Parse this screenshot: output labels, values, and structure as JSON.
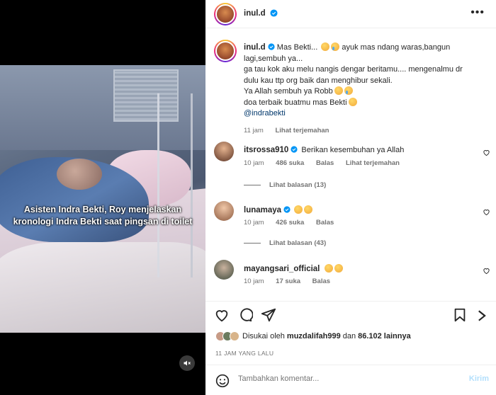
{
  "video": {
    "caption": "Asisten Indra Bekti, Roy menjelaskan kronologi Indra Bekti saat pingsan di toilet"
  },
  "post": {
    "author": "inul.d"
  },
  "caption": {
    "author": "inul.d",
    "line1": "Mas Bekti...",
    "line1b": "ayuk mas ndang waras,bangun",
    "line2": "lagi,sembuh ya...",
    "line3": "ga tau kok aku melu nangis dengar beritamu.... mengenalmu dr",
    "line4": "dulu kau ttp org baik dan menghibur sekali.",
    "line5": "Ya Allah sembuh ya Robb",
    "line6": "doa terbaik buatmu mas Bekti",
    "mention": "@indrabekti",
    "time": "11 jam",
    "translate": "Lihat terjemahan"
  },
  "comments": [
    {
      "user": "itsrossa910",
      "text": "Berikan kesembuhan ya Allah",
      "time": "10 jam",
      "likes": "486 suka",
      "reply": "Balas",
      "translate": "Lihat terjemahan",
      "view_replies": "Lihat balasan (13)"
    },
    {
      "user": "lunamaya",
      "text": "",
      "time": "10 jam",
      "likes": "426 suka",
      "reply": "Balas",
      "view_replies": "Lihat balasan (43)"
    },
    {
      "user": "mayangsari_official",
      "text": "",
      "time": "10 jam",
      "likes": "17 suka",
      "reply": "Balas"
    }
  ],
  "likes": {
    "prefix": "Disukai oleh",
    "user": "muzdalifah999",
    "mid": "dan",
    "count": "86.102 lainnya"
  },
  "timestamp": "11 JAM YANG LALU",
  "add_comment": {
    "placeholder": "Tambahkan komentar...",
    "post_label": "Kirim"
  },
  "colors": {
    "verified": "#0095f6",
    "link": "#00376b",
    "muted": "#737373",
    "post_disabled": "#b2dffc"
  }
}
